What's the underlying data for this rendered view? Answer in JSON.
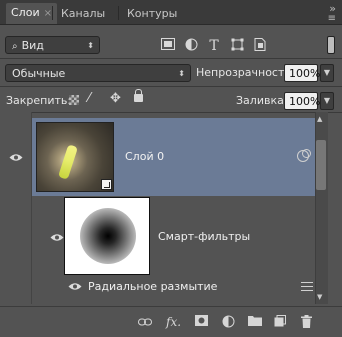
{
  "tabs": [
    {
      "label": "Слои",
      "active": true
    },
    {
      "label": "Каналы",
      "active": false
    },
    {
      "label": "Контуры",
      "active": false
    }
  ],
  "panel_menu_icon": "menu-icon",
  "filter": {
    "kind_label": "Вид",
    "icons": [
      "image-filter-icon",
      "adjustment-filter-icon",
      "type-filter-icon",
      "shape-filter-icon",
      "smart-object-filter-icon"
    ]
  },
  "blend": {
    "mode": "Обычные",
    "opacity_label": "Непрозрачность:",
    "opacity_value": "100%"
  },
  "lock": {
    "label": "Закрепить:",
    "fill_label": "Заливка:",
    "fill_value": "100%"
  },
  "layers": [
    {
      "name": "Слой 0",
      "selected": true,
      "visible": true,
      "is_smart_object": true
    },
    {
      "name": "Смарт-фильтры",
      "visible": true
    },
    {
      "name": "Радиальное размытие",
      "visible": true
    }
  ],
  "footer_icons": [
    "link-layers-icon",
    "fx-icon",
    "add-mask-icon",
    "adjustment-layer-icon",
    "new-group-icon",
    "new-layer-icon",
    "delete-icon"
  ],
  "colors": {
    "panel_bg": "#535353",
    "selected": "#6b7b96",
    "tab_bar": "#3a3a3a"
  }
}
